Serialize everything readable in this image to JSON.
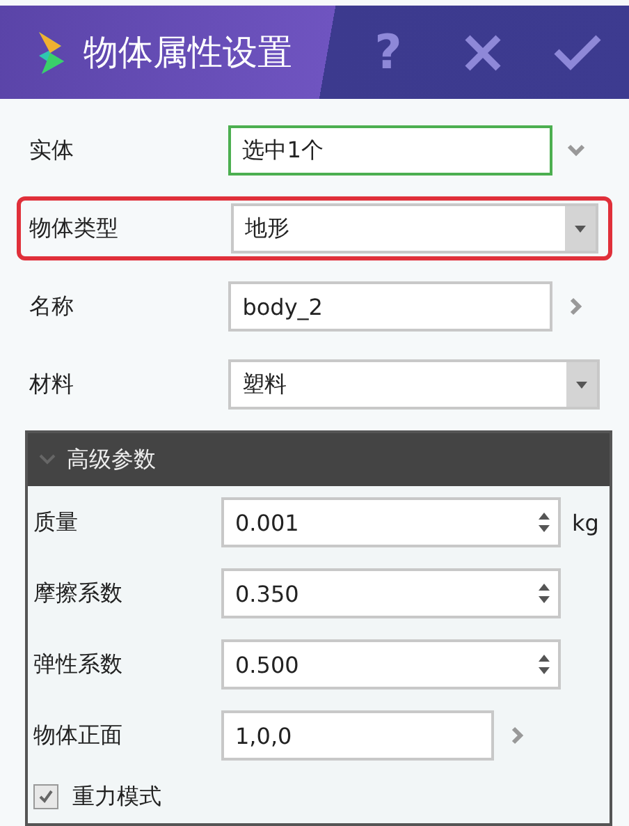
{
  "window": {
    "title": "物体属性设置",
    "buttons": [
      {
        "kind": "help",
        "label": "?"
      },
      {
        "kind": "close"
      },
      {
        "kind": "confirm"
      }
    ]
  },
  "fields": [
    {
      "label": "实体",
      "value": "选中1个",
      "kind": "picker",
      "focused": true,
      "highlighted": false
    },
    {
      "label": "物体类型",
      "value": "地形",
      "kind": "dropdown",
      "focused": false,
      "highlighted": true
    },
    {
      "label": "名称",
      "value": "body_2",
      "kind": "link",
      "focused": false,
      "highlighted": false
    },
    {
      "label": "材料",
      "value": "塑料",
      "kind": "dropdown",
      "focused": false,
      "highlighted": false
    }
  ],
  "advanced": {
    "title": "高级参数",
    "expanded": true,
    "rows": [
      {
        "label": "质量",
        "value": "0.001",
        "kind": "spin",
        "unit": "kg"
      },
      {
        "label": "摩擦系数",
        "value": "0.350",
        "kind": "spin"
      },
      {
        "label": "弹性系数",
        "value": "0.500",
        "kind": "spin"
      },
      {
        "label": "物体正面",
        "value": "1,0,0",
        "kind": "link"
      }
    ],
    "checkbox": {
      "label": "重力模式",
      "checked": true
    }
  }
}
